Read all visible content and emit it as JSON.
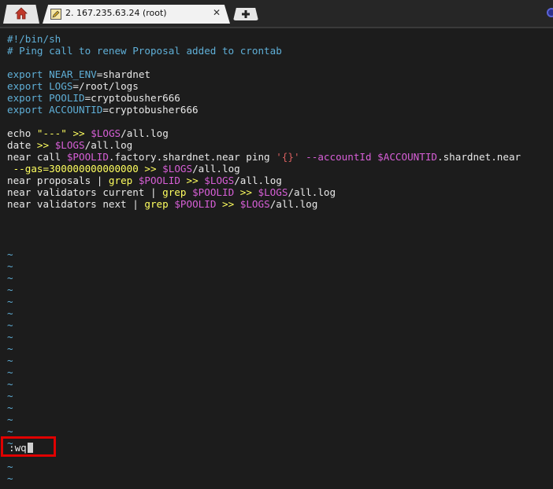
{
  "tabbar": {
    "home_icon": "home-icon",
    "session_tab": {
      "icon": "pencil-icon",
      "title": "2. 167.235.63.24 (root)",
      "close": "✕"
    },
    "new_tab_icon": "plus-icon"
  },
  "editor": {
    "lines": [
      [
        {
          "t": "#!/bin/sh",
          "c": "comment"
        }
      ],
      [
        {
          "t": "# Ping call to renew Proposal added to crontab",
          "c": "comment"
        }
      ],
      [],
      [
        {
          "t": "export ",
          "c": "kw"
        },
        {
          "t": "NEAR_ENV",
          "c": "var"
        },
        {
          "t": "=shardnet",
          "c": "fg"
        }
      ],
      [
        {
          "t": "export ",
          "c": "kw"
        },
        {
          "t": "LOGS",
          "c": "var"
        },
        {
          "t": "=/root/logs",
          "c": "fg"
        }
      ],
      [
        {
          "t": "export ",
          "c": "kw"
        },
        {
          "t": "POOLID",
          "c": "var"
        },
        {
          "t": "=cryptobusher666",
          "c": "fg"
        }
      ],
      [
        {
          "t": "export ",
          "c": "kw"
        },
        {
          "t": "ACCOUNTID",
          "c": "var"
        },
        {
          "t": "=cryptobusher666",
          "c": "fg"
        }
      ],
      [],
      [
        {
          "t": "echo ",
          "c": "fg"
        },
        {
          "t": "\"---\"",
          "c": "op"
        },
        {
          "t": " ",
          "c": "fg"
        },
        {
          "t": ">>",
          "c": "op"
        },
        {
          "t": " ",
          "c": "fg"
        },
        {
          "t": "$LOGS",
          "c": "dvar"
        },
        {
          "t": "/all.log",
          "c": "fg"
        }
      ],
      [
        {
          "t": "date ",
          "c": "fg"
        },
        {
          "t": ">>",
          "c": "op"
        },
        {
          "t": " ",
          "c": "fg"
        },
        {
          "t": "$LOGS",
          "c": "dvar"
        },
        {
          "t": "/all.log",
          "c": "fg"
        }
      ],
      [
        {
          "t": "near call ",
          "c": "fg"
        },
        {
          "t": "$POOLID",
          "c": "dvar"
        },
        {
          "t": ".factory.shardnet.near ping ",
          "c": "fg"
        },
        {
          "t": "'{}'",
          "c": "str"
        },
        {
          "t": " ",
          "c": "fg"
        },
        {
          "t": "--accountId",
          "c": "dvar"
        },
        {
          "t": " ",
          "c": "fg"
        },
        {
          "t": "$ACCOUNTID",
          "c": "dvar"
        },
        {
          "t": ".shardnet.near",
          "c": "fg"
        }
      ],
      [
        {
          "t": " --gas=300000000000000",
          "c": "op"
        },
        {
          "t": " ",
          "c": "fg"
        },
        {
          "t": ">>",
          "c": "op"
        },
        {
          "t": " ",
          "c": "fg"
        },
        {
          "t": "$LOGS",
          "c": "dvar"
        },
        {
          "t": "/all.log",
          "c": "fg"
        }
      ],
      [
        {
          "t": "near proposals | ",
          "c": "fg"
        },
        {
          "t": "grep",
          "c": "op"
        },
        {
          "t": " ",
          "c": "fg"
        },
        {
          "t": "$POOLID",
          "c": "dvar"
        },
        {
          "t": " ",
          "c": "fg"
        },
        {
          "t": ">>",
          "c": "op"
        },
        {
          "t": " ",
          "c": "fg"
        },
        {
          "t": "$LOGS",
          "c": "dvar"
        },
        {
          "t": "/all.log",
          "c": "fg"
        }
      ],
      [
        {
          "t": "near validators current | ",
          "c": "fg"
        },
        {
          "t": "grep",
          "c": "op"
        },
        {
          "t": " ",
          "c": "fg"
        },
        {
          "t": "$POOLID",
          "c": "dvar"
        },
        {
          "t": " ",
          "c": "fg"
        },
        {
          "t": ">>",
          "c": "op"
        },
        {
          "t": " ",
          "c": "fg"
        },
        {
          "t": "$LOGS",
          "c": "dvar"
        },
        {
          "t": "/all.log",
          "c": "fg"
        }
      ],
      [
        {
          "t": "near validators next | ",
          "c": "fg"
        },
        {
          "t": "grep",
          "c": "op"
        },
        {
          "t": " ",
          "c": "fg"
        },
        {
          "t": "$POOLID",
          "c": "dvar"
        },
        {
          "t": " ",
          "c": "fg"
        },
        {
          "t": ">>",
          "c": "op"
        },
        {
          "t": " ",
          "c": "fg"
        },
        {
          "t": "$LOGS",
          "c": "dvar"
        },
        {
          "t": "/all.log",
          "c": "fg"
        }
      ]
    ],
    "tilde_char": "~",
    "tilde_lines": 20
  },
  "command_line": {
    "text": ":wq"
  },
  "colors": {
    "background": "#1c1c1c",
    "comment": "#5fafd7",
    "operator": "#ffff5f",
    "dollar_var": "#d75fd7",
    "string": "#d75f5f",
    "highlight_box": "#e00000"
  }
}
